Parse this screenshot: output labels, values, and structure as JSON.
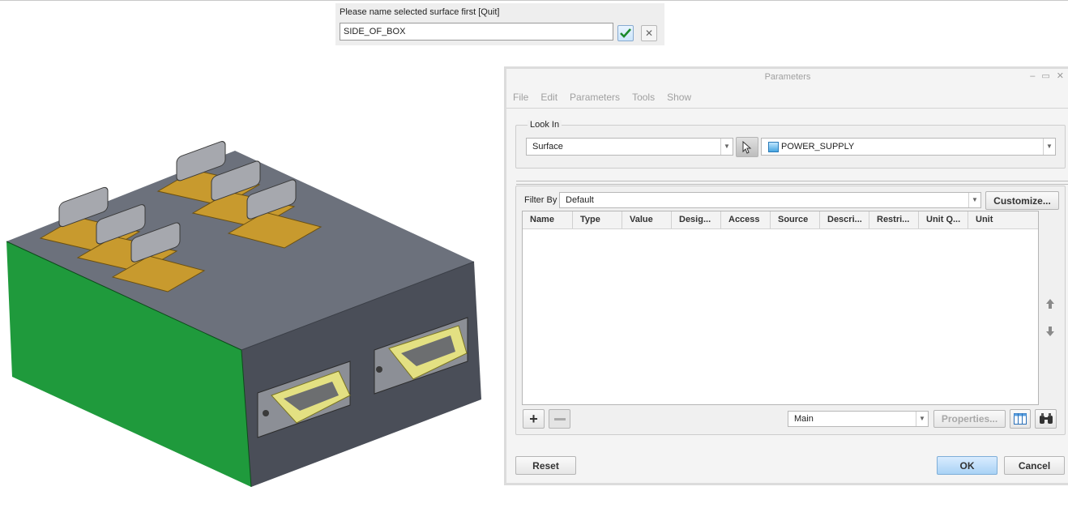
{
  "prompt": {
    "label": "Please name selected surface first [Quit]",
    "input_value": "SIDE_OF_BOX",
    "confirm_icon": "check-icon",
    "cancel_icon": "close-icon"
  },
  "dialog": {
    "title": "Parameters",
    "menu": [
      "File",
      "Edit",
      "Parameters",
      "Tools",
      "Show"
    ],
    "look_in": {
      "title": "Look In",
      "type_value": "Surface",
      "object_value": "POWER_SUPPLY"
    },
    "filter": {
      "label": "Filter By",
      "value": "Default",
      "customize_label": "Customize..."
    },
    "columns": [
      "Name",
      "Type",
      "Value",
      "Desig...",
      "Access",
      "Source",
      "Descri...",
      "Restri...",
      "Unit Q...",
      "Unit"
    ],
    "rows": [],
    "table_controls": {
      "view_value": "Main",
      "properties_label": "Properties..."
    },
    "reset_label": "Reset",
    "ok_label": "OK",
    "cancel_label": "Cancel"
  },
  "colors": {
    "selected_surface": "#1f9a3c",
    "box_top": "#6c717c",
    "box_front": "#4a4e58",
    "connector_shell": "#e3e082",
    "connector_flange": "#c8a030",
    "accent": "#a9d2f5"
  }
}
